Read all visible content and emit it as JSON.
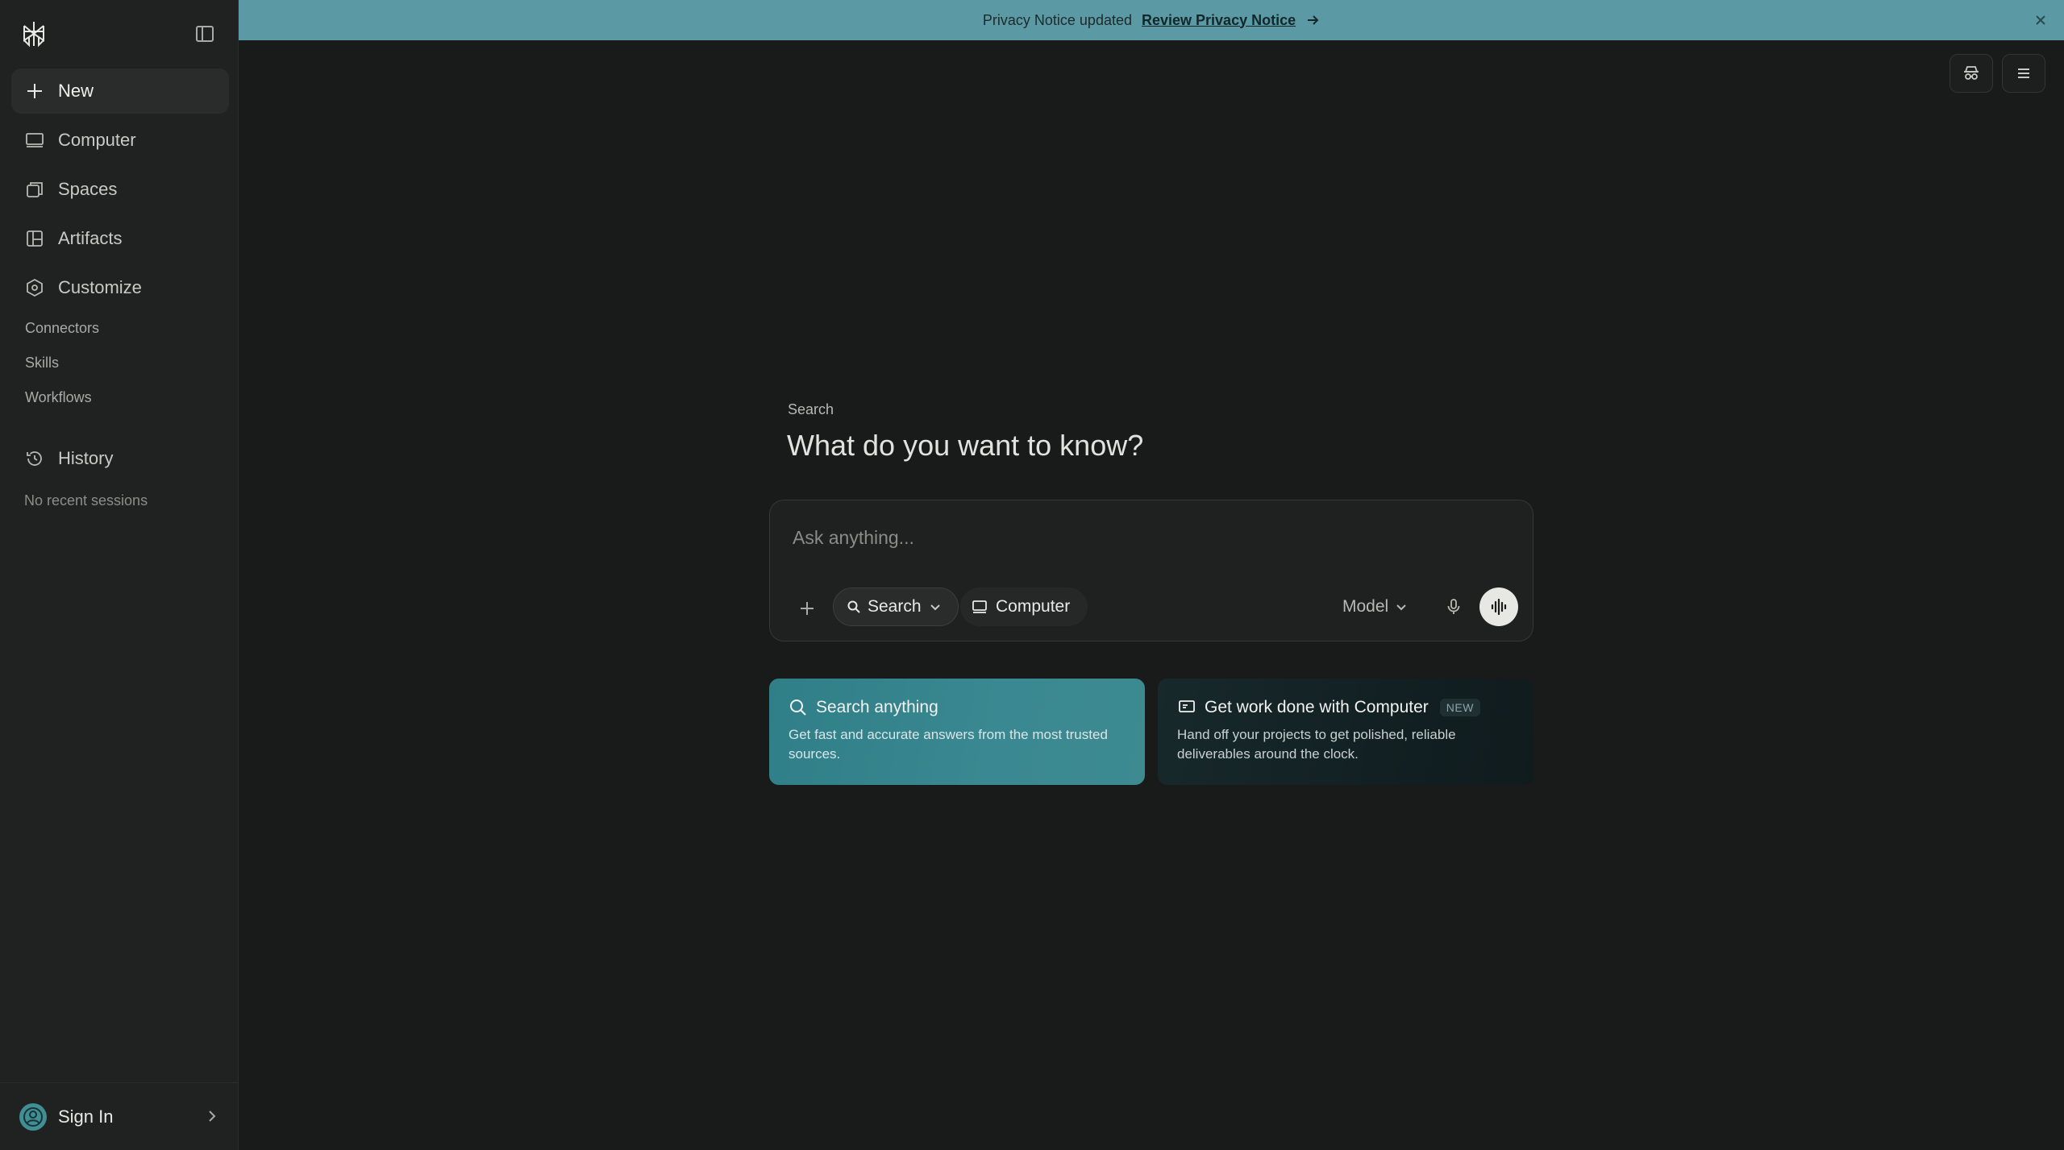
{
  "banner": {
    "text": "Privacy Notice updated",
    "link": "Review Privacy Notice"
  },
  "sidebar": {
    "items": [
      {
        "label": "New",
        "icon": "plus-icon"
      },
      {
        "label": "Computer",
        "icon": "computer-icon"
      },
      {
        "label": "Spaces",
        "icon": "spaces-icon"
      },
      {
        "label": "Artifacts",
        "icon": "artifacts-icon"
      },
      {
        "label": "Customize",
        "icon": "hexagon-icon"
      }
    ],
    "sub_items": [
      "Connectors",
      "Skills",
      "Workflows"
    ],
    "history_label": "History",
    "no_recent": "No recent sessions",
    "sign_in": "Sign In"
  },
  "main": {
    "label": "Search",
    "title": "What do you want to know?",
    "composer": {
      "placeholder": "Ask anything...",
      "search_mode": "Search",
      "computer_mode": "Computer",
      "model": "Model"
    },
    "cards": [
      {
        "title": "Search anything",
        "desc": "Get fast and accurate answers from the most trusted sources."
      },
      {
        "title": "Get work done with Computer",
        "badge": "NEW",
        "desc": "Hand off your projects to get polished, reliable deliverables around the clock."
      }
    ]
  },
  "colors": {
    "accent": "#5b9aa5",
    "background": "#191a1a",
    "sidebar": "#202222"
  }
}
